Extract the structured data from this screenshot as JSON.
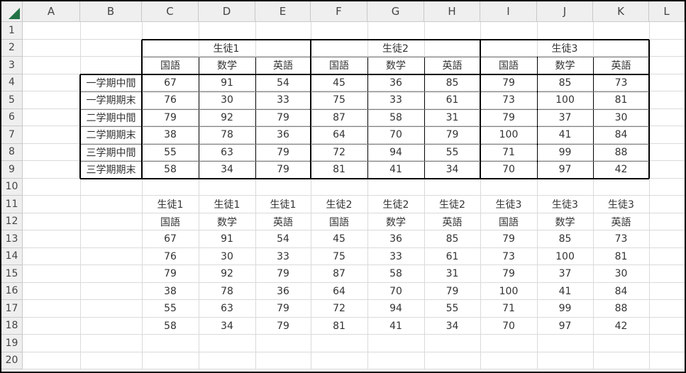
{
  "sheet": {
    "columns": [
      "A",
      "B",
      "C",
      "D",
      "E",
      "F",
      "G",
      "H",
      "I",
      "J",
      "K",
      "L"
    ],
    "rows": [
      "1",
      "2",
      "3",
      "4",
      "5",
      "6",
      "7",
      "8",
      "9",
      "10",
      "11",
      "12",
      "13",
      "14",
      "15",
      "16",
      "17",
      "18",
      "19",
      "20"
    ],
    "colors": {
      "corner_triangle": "#217346",
      "header_bg": "#efefef",
      "gridline": "#dadada"
    }
  },
  "table1": {
    "students": [
      "生徒1",
      "生徒2",
      "生徒3"
    ],
    "subjects": [
      "国語",
      "数学",
      "英語",
      "国語",
      "数学",
      "英語",
      "国語",
      "数学",
      "英語"
    ],
    "terms": [
      "一学期中間",
      "一学期期末",
      "二学期中間",
      "二学期期末",
      "三学期中間",
      "三学期期末"
    ],
    "values": [
      [
        "67",
        "91",
        "54",
        "45",
        "36",
        "85",
        "79",
        "85",
        "73"
      ],
      [
        "76",
        "30",
        "33",
        "75",
        "33",
        "61",
        "73",
        "100",
        "81"
      ],
      [
        "79",
        "92",
        "79",
        "87",
        "58",
        "31",
        "79",
        "37",
        "30"
      ],
      [
        "38",
        "78",
        "36",
        "64",
        "70",
        "79",
        "100",
        "41",
        "84"
      ],
      [
        "55",
        "63",
        "79",
        "72",
        "94",
        "55",
        "71",
        "99",
        "88"
      ],
      [
        "58",
        "34",
        "79",
        "81",
        "41",
        "34",
        "70",
        "97",
        "42"
      ]
    ]
  },
  "table2": {
    "students": [
      "生徒1",
      "生徒1",
      "生徒1",
      "生徒2",
      "生徒2",
      "生徒2",
      "生徒3",
      "生徒3",
      "生徒3"
    ],
    "subjects": [
      "国語",
      "数学",
      "英語",
      "国語",
      "数学",
      "英語",
      "国語",
      "数学",
      "英語"
    ],
    "values": [
      [
        "67",
        "91",
        "54",
        "45",
        "36",
        "85",
        "79",
        "85",
        "73"
      ],
      [
        "76",
        "30",
        "33",
        "75",
        "33",
        "61",
        "73",
        "100",
        "81"
      ],
      [
        "79",
        "92",
        "79",
        "87",
        "58",
        "31",
        "79",
        "37",
        "30"
      ],
      [
        "38",
        "78",
        "36",
        "64",
        "70",
        "79",
        "100",
        "41",
        "84"
      ],
      [
        "55",
        "63",
        "79",
        "72",
        "94",
        "55",
        "71",
        "99",
        "88"
      ],
      [
        "58",
        "34",
        "79",
        "81",
        "41",
        "34",
        "70",
        "97",
        "42"
      ]
    ]
  }
}
